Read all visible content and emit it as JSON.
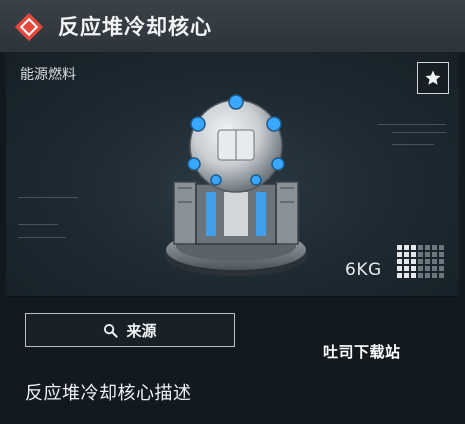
{
  "header": {
    "title": "反应堆冷却核心",
    "rarity_color": "#e5493d"
  },
  "item": {
    "category": "能源燃料",
    "weight": "6KG",
    "image_icon": "reactor-core-icon",
    "favorite_icon": "star-icon"
  },
  "actions": {
    "source_label": "来源",
    "source_icon": "search-icon"
  },
  "description": {
    "title": "反应堆冷却核心描述"
  },
  "watermark": "吐司下载站",
  "colors": {
    "header_bg": "#333a40",
    "panel_bg": "#121a20",
    "accent_blue": "#3aa7ff"
  }
}
